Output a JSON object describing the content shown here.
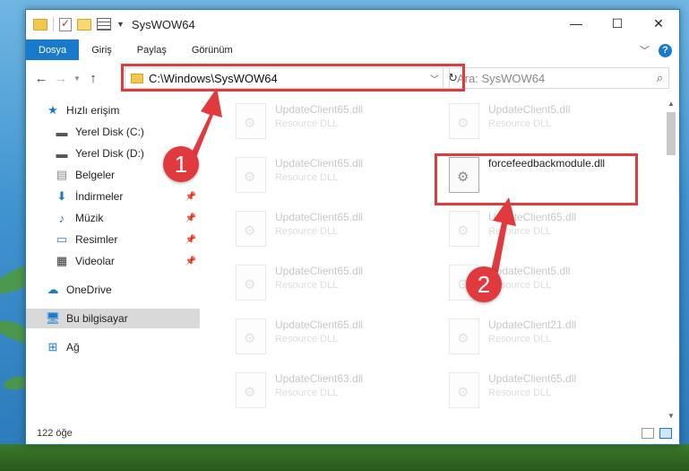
{
  "window": {
    "title": "SysWOW64"
  },
  "ribbon": {
    "tabs": [
      {
        "label": "Dosya",
        "active": true
      },
      {
        "label": "Giriş"
      },
      {
        "label": "Paylaş"
      },
      {
        "label": "Görünüm"
      }
    ],
    "help_label": "?"
  },
  "address": {
    "path": "C:\\Windows\\SysWOW64",
    "search_placeholder": "Ara: SysWOW64"
  },
  "sidebar": {
    "items": [
      {
        "label": "Hızlı erişim",
        "icon": "star-icon"
      },
      {
        "label": "Yerel Disk (C:)",
        "icon": "drive-icon"
      },
      {
        "label": "Yerel Disk (D:)",
        "icon": "drive-icon"
      },
      {
        "label": "Belgeler",
        "icon": "documents-icon"
      },
      {
        "label": "İndirmeler",
        "icon": "download-icon",
        "pinned": true
      },
      {
        "label": "Müzik",
        "icon": "music-icon",
        "pinned": true
      },
      {
        "label": "Resimler",
        "icon": "pictures-icon",
        "pinned": true
      },
      {
        "label": "Videolar",
        "icon": "video-icon",
        "pinned": true
      },
      {
        "label": "OneDrive",
        "icon": "cloud-icon"
      },
      {
        "label": "Bu bilgisayar",
        "icon": "computer-icon",
        "selected": true
      },
      {
        "label": "Ağ",
        "icon": "network-icon"
      }
    ]
  },
  "files": {
    "left": [
      {
        "name": "UpdateClient65.dll",
        "type": "Resource DLL"
      },
      {
        "name": "UpdateClient65.dll",
        "type": "Resource DLL"
      },
      {
        "name": "UpdateClient65.dll",
        "type": "Resource DLL"
      },
      {
        "name": "UpdateClient65.dll",
        "type": "Resource DLL"
      },
      {
        "name": "UpdateClient65.dll",
        "type": "Resource DLL"
      },
      {
        "name": "UpdateClient63.dll",
        "type": "Resource DLL"
      }
    ],
    "right": [
      {
        "name": "UpdateClient5.dll",
        "type": "Resource DLL"
      },
      {
        "name": "forcefeedbackmodule.dll",
        "type": "",
        "highlighted": true
      },
      {
        "name": "UpdateClient65.dll",
        "type": "Resource DLL"
      },
      {
        "name": "UpdateClient5.dll",
        "type": "Resource DLL"
      },
      {
        "name": "UpdateClient21.dll",
        "type": "Resource DLL"
      },
      {
        "name": "UpdateClient65.dll",
        "type": "Resource DLL"
      }
    ]
  },
  "status": {
    "item_count": "122 öğe"
  },
  "steps": {
    "one": "1",
    "two": "2"
  },
  "colors": {
    "accent": "#1979ca",
    "highlight": "#e0393e"
  }
}
